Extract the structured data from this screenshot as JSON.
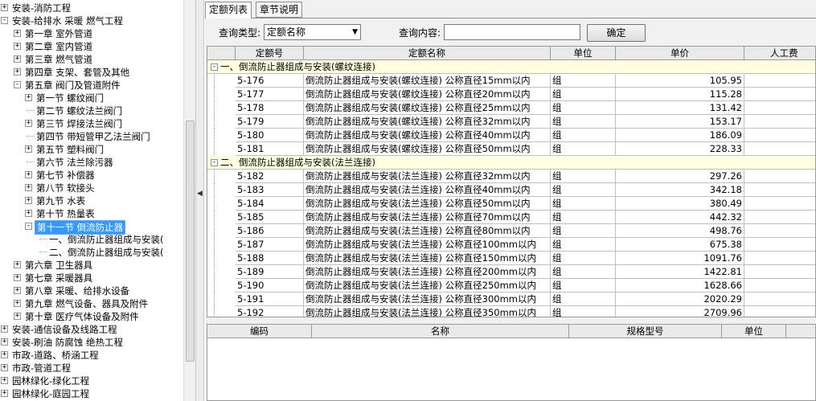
{
  "tree": {
    "items": [
      {
        "label": "安装-消防工程",
        "level": 0,
        "toggle": "+"
      },
      {
        "label": "安装-给排水 采暖 燃气工程",
        "level": 0,
        "toggle": "-"
      },
      {
        "label": "第一章 室外管道",
        "level": 1,
        "toggle": "+"
      },
      {
        "label": "第二章 室内管道",
        "level": 1,
        "toggle": "+"
      },
      {
        "label": "第三章 燃气管道",
        "level": 1,
        "toggle": "+"
      },
      {
        "label": "第四章 支架、套管及其他",
        "level": 1,
        "toggle": "+"
      },
      {
        "label": "第五章 阀门及管道附件",
        "level": 1,
        "toggle": "-"
      },
      {
        "label": "第一节 螺纹阀门",
        "level": 2,
        "toggle": "+"
      },
      {
        "label": "第二节 螺纹法兰阀门",
        "level": 2,
        "toggle": ""
      },
      {
        "label": "第三节 焊接法兰阀门",
        "level": 2,
        "toggle": "+"
      },
      {
        "label": "第四节 带短管甲乙法兰阀门",
        "level": 2,
        "toggle": ""
      },
      {
        "label": "第五节 塑料阀门",
        "level": 2,
        "toggle": "+"
      },
      {
        "label": "第六节 法兰除污器",
        "level": 2,
        "toggle": ""
      },
      {
        "label": "第七节 补偿器",
        "level": 2,
        "toggle": "+"
      },
      {
        "label": "第八节 软接头",
        "level": 2,
        "toggle": "+"
      },
      {
        "label": "第九节 水表",
        "level": 2,
        "toggle": "+"
      },
      {
        "label": "第十节 热量表",
        "level": 2,
        "toggle": "+"
      },
      {
        "label": "第十一节 倒流防止器",
        "level": 2,
        "toggle": "-",
        "selected": true
      },
      {
        "label": "一、倒流防止器组成与安装(",
        "level": 3,
        "toggle": ""
      },
      {
        "label": "二、倒流防止器组成与安装(",
        "level": 3,
        "toggle": ""
      },
      {
        "label": "第六章 卫生器具",
        "level": 1,
        "toggle": "+"
      },
      {
        "label": "第七章 采暖器具",
        "level": 1,
        "toggle": "+"
      },
      {
        "label": "第八章 采暖、给排水设备",
        "level": 1,
        "toggle": "+"
      },
      {
        "label": "第九章 燃气设备、器具及附件",
        "level": 1,
        "toggle": "+"
      },
      {
        "label": "第十章 医疗气体设备及附件",
        "level": 1,
        "toggle": "+"
      },
      {
        "label": "安装-通信设备及线路工程",
        "level": 0,
        "toggle": "+"
      },
      {
        "label": "安装-刷油 防腐蚀 绝热工程",
        "level": 0,
        "toggle": "+"
      },
      {
        "label": "市政-道路、桥涵工程",
        "level": 0,
        "toggle": "+"
      },
      {
        "label": "市政-管道工程",
        "level": 0,
        "toggle": "+"
      },
      {
        "label": "园林绿化-绿化工程",
        "level": 0,
        "toggle": "+"
      },
      {
        "label": "园林绿化-庭园工程",
        "level": 0,
        "toggle": "+"
      }
    ]
  },
  "tabs": [
    {
      "label": "定额列表",
      "active": true
    },
    {
      "label": "章节说明",
      "active": false
    }
  ],
  "query": {
    "type_label": "查询类型:",
    "type_value": "定额名称",
    "content_label": "查询内容:",
    "content_value": "",
    "button_label": "确定"
  },
  "grid1": {
    "columns": [
      "定额号",
      "定额名称",
      "单位",
      "单价",
      "人工费"
    ],
    "groups": [
      {
        "label": "一、倒流防止器组成与安装(螺纹连接)",
        "rows": [
          {
            "code": "5-176",
            "name": "倒流防止器组成与安装(螺纹连接) 公称直径15mm以内",
            "unit": "组",
            "price": "105.95"
          },
          {
            "code": "5-177",
            "name": "倒流防止器组成与安装(螺纹连接) 公称直径20mm以内",
            "unit": "组",
            "price": "115.28"
          },
          {
            "code": "5-178",
            "name": "倒流防止器组成与安装(螺纹连接) 公称直径25mm以内",
            "unit": "组",
            "price": "131.42"
          },
          {
            "code": "5-179",
            "name": "倒流防止器组成与安装(螺纹连接) 公称直径32mm以内",
            "unit": "组",
            "price": "153.17"
          },
          {
            "code": "5-180",
            "name": "倒流防止器组成与安装(螺纹连接) 公称直径40mm以内",
            "unit": "组",
            "price": "186.09"
          },
          {
            "code": "5-181",
            "name": "倒流防止器组成与安装(螺纹连接) 公称直径50mm以内",
            "unit": "组",
            "price": "228.33"
          }
        ]
      },
      {
        "label": "二、倒流防止器组成与安装(法兰连接)",
        "rows": [
          {
            "code": "5-182",
            "name": "倒流防止器组成与安装(法兰连接) 公称直径32mm以内",
            "unit": "组",
            "price": "297.26"
          },
          {
            "code": "5-183",
            "name": "倒流防止器组成与安装(法兰连接) 公称直径40mm以内",
            "unit": "组",
            "price": "342.18"
          },
          {
            "code": "5-184",
            "name": "倒流防止器组成与安装(法兰连接) 公称直径50mm以内",
            "unit": "组",
            "price": "380.49"
          },
          {
            "code": "5-185",
            "name": "倒流防止器组成与安装(法兰连接) 公称直径70mm以内",
            "unit": "组",
            "price": "442.32"
          },
          {
            "code": "5-186",
            "name": "倒流防止器组成与安装(法兰连接) 公称直径80mm以内",
            "unit": "组",
            "price": "498.76"
          },
          {
            "code": "5-187",
            "name": "倒流防止器组成与安装(法兰连接) 公称直径100mm以内",
            "unit": "组",
            "price": "675.38"
          },
          {
            "code": "5-188",
            "name": "倒流防止器组成与安装(法兰连接) 公称直径150mm以内",
            "unit": "组",
            "price": "1091.76"
          },
          {
            "code": "5-189",
            "name": "倒流防止器组成与安装(法兰连接) 公称直径200mm以内",
            "unit": "组",
            "price": "1422.81"
          },
          {
            "code": "5-190",
            "name": "倒流防止器组成与安装(法兰连接) 公称直径250mm以内",
            "unit": "组",
            "price": "1628.66"
          },
          {
            "code": "5-191",
            "name": "倒流防止器组成与安装(法兰连接) 公称直径300mm以内",
            "unit": "组",
            "price": "2020.29"
          },
          {
            "code": "5-192",
            "name": "倒流防止器组成与安装(法兰连接) 公称直径350mm以内",
            "unit": "组",
            "price": "2709.96"
          }
        ]
      }
    ]
  },
  "grid2": {
    "columns": [
      "编码",
      "名称",
      "规格型号",
      "单位"
    ]
  },
  "colors": {
    "selection": "#3399ff",
    "group_row": "#ffffe0",
    "header": "#eaeaea"
  }
}
